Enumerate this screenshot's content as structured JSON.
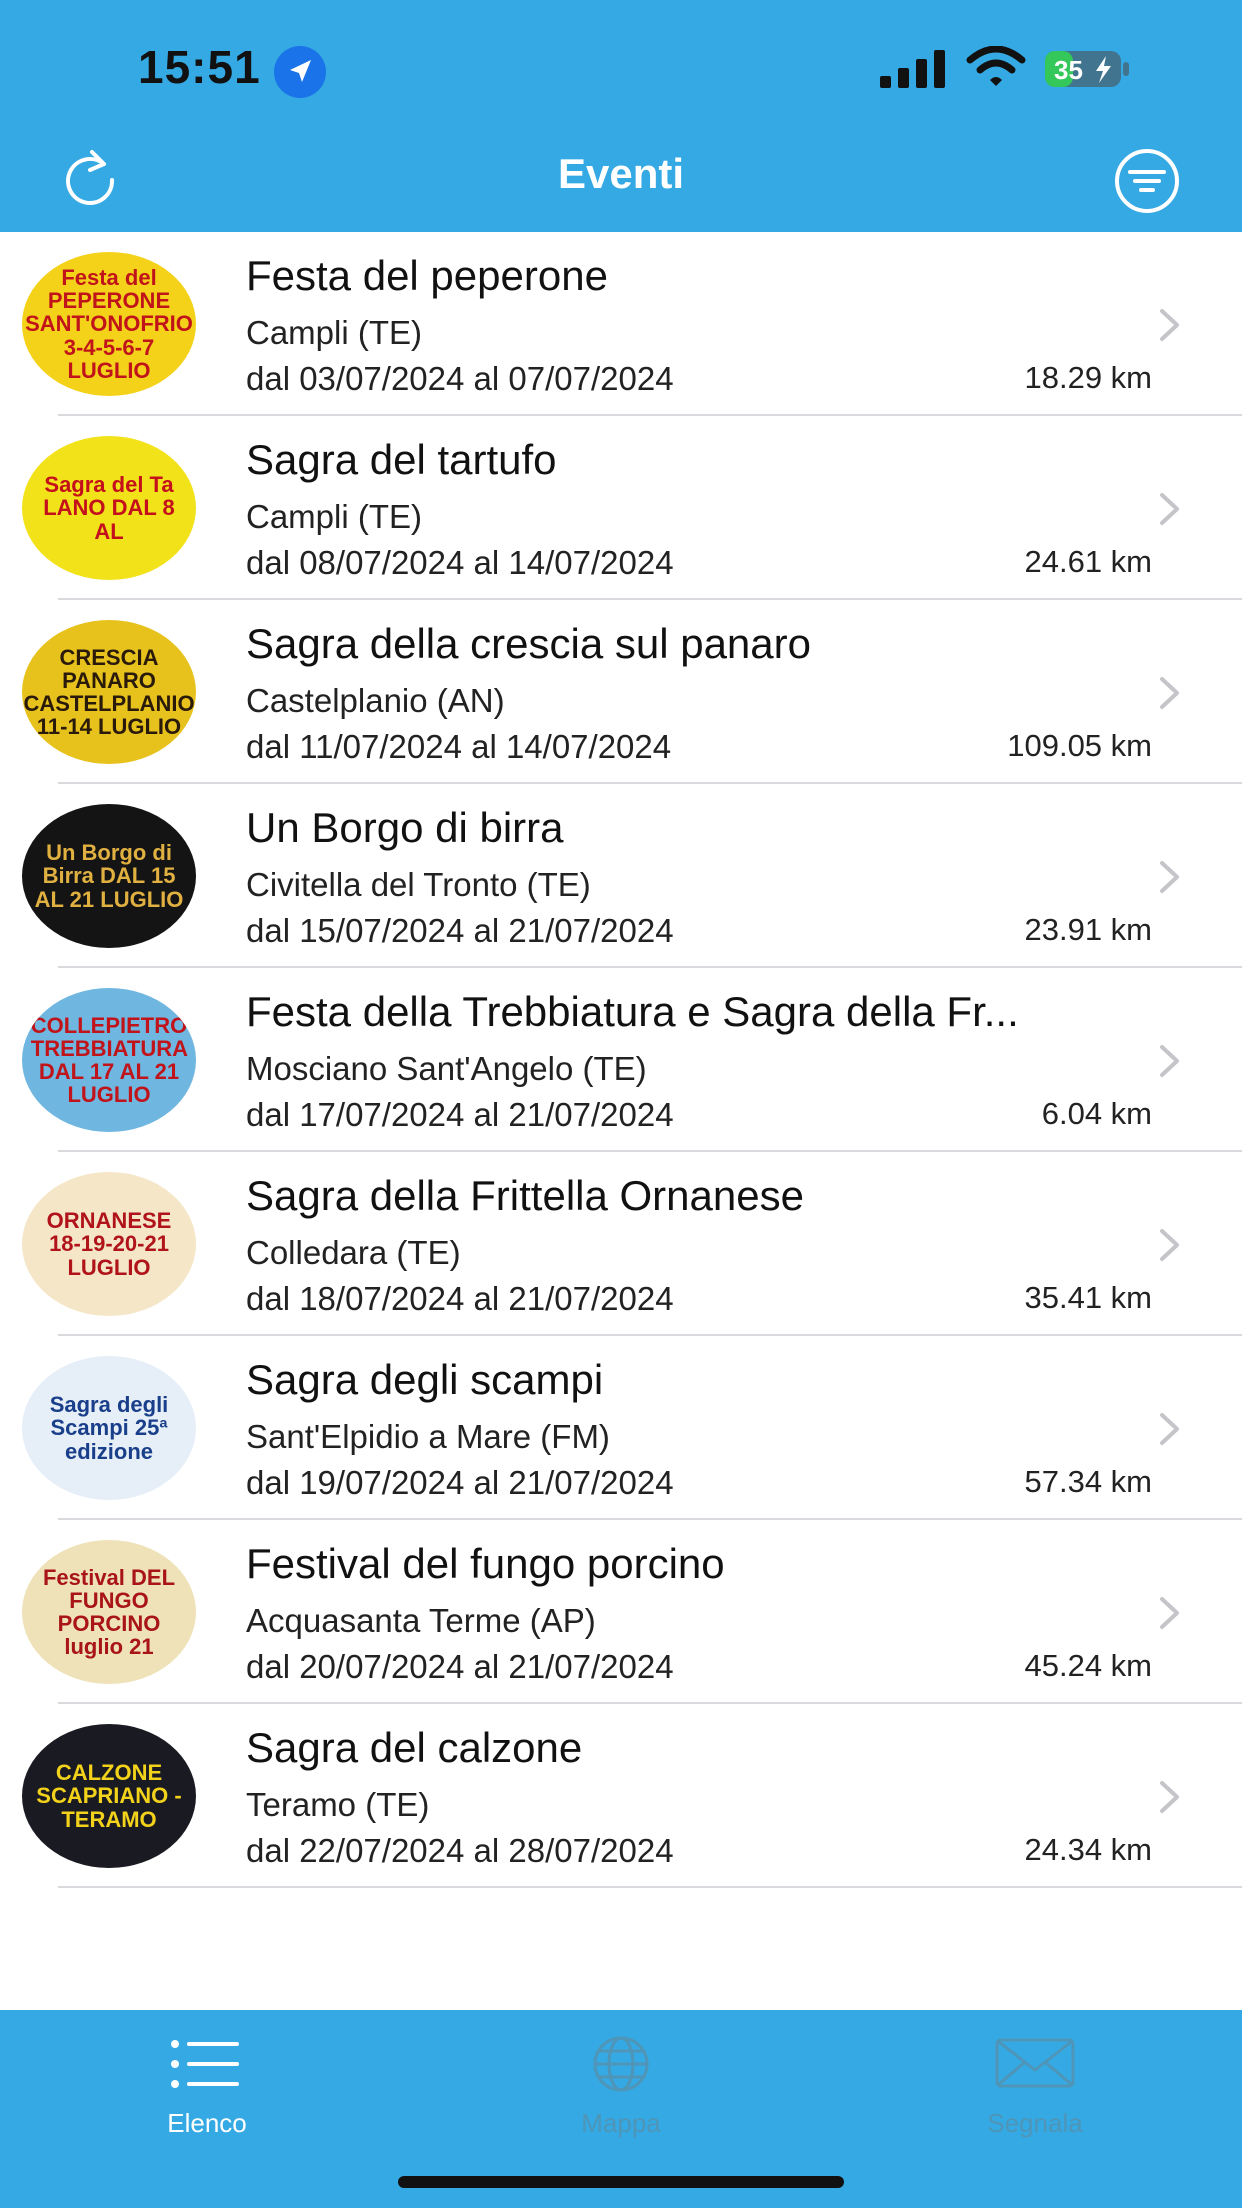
{
  "status": {
    "time": "15:51",
    "battery": "35"
  },
  "header": {
    "title": "Eventi"
  },
  "events": [
    {
      "title": "Festa del peperone",
      "place": "Campli (TE)",
      "dates": "dal 03/07/2024 al 07/07/2024",
      "distance": "18.29 km",
      "thumb_text": "Festa del PEPERONE SANT'ONOFRIO 3-4-5-6-7 LUGLIO",
      "thumb_bg": "#f4d21a",
      "thumb_fg": "#c0141a"
    },
    {
      "title": "Sagra del tartufo",
      "place": "Campli (TE)",
      "dates": "dal 08/07/2024 al 14/07/2024",
      "distance": "24.61 km",
      "thumb_text": "Sagra del Ta LANO DAL 8 AL",
      "thumb_bg": "#f2e21a",
      "thumb_fg": "#c4101a"
    },
    {
      "title": "Sagra della crescia sul panaro",
      "place": "Castelplanio (AN)",
      "dates": "dal 11/07/2024 al 14/07/2024",
      "distance": "109.05 km",
      "thumb_text": "CRESCIA PANARO CASTELPLANIO 11-14 LUGLIO",
      "thumb_bg": "#e8c21c",
      "thumb_fg": "#2a1a0a"
    },
    {
      "title": "Un Borgo di birra",
      "place": "Civitella del Tronto (TE)",
      "dates": "dal 15/07/2024 al 21/07/2024",
      "distance": "23.91 km",
      "thumb_text": "Un Borgo di Birra DAL 15 AL 21 LUGLIO",
      "thumb_bg": "#141414",
      "thumb_fg": "#e0b040"
    },
    {
      "title": "Festa della Trebbiatura e Sagra della Fr...",
      "place": "Mosciano Sant'Angelo (TE)",
      "dates": "dal 17/07/2024 al 21/07/2024",
      "distance": "6.04 km",
      "thumb_text": "COLLEPIETRO TREBBIATURA DAL 17 AL 21 LUGLIO",
      "thumb_bg": "#6fb6e0",
      "thumb_fg": "#c0141a"
    },
    {
      "title": "Sagra della Frittella Ornanese",
      "place": "Colledara (TE)",
      "dates": "dal 18/07/2024 al 21/07/2024",
      "distance": "35.41 km",
      "thumb_text": "ORNANESE 18-19-20-21 LUGLIO",
      "thumb_bg": "#f5e6c8",
      "thumb_fg": "#b0141a"
    },
    {
      "title": "Sagra degli scampi",
      "place": "Sant'Elpidio a Mare (FM)",
      "dates": "dal 19/07/2024 al 21/07/2024",
      "distance": "57.34 km",
      "thumb_text": "Sagra degli Scampi 25ª edizione",
      "thumb_bg": "#e6eef8",
      "thumb_fg": "#1a3f8a"
    },
    {
      "title": "Festival del fungo porcino",
      "place": "Acquasanta Terme (AP)",
      "dates": "dal 20/07/2024 al 21/07/2024",
      "distance": "45.24 km",
      "thumb_text": "Festival DEL FUNGO PORCINO luglio 21",
      "thumb_bg": "#efe2b8",
      "thumb_fg": "#a8141a"
    },
    {
      "title": "Sagra del calzone",
      "place": "Teramo (TE)",
      "dates": "dal 22/07/2024 al 28/07/2024",
      "distance": "24.34 km",
      "thumb_text": "CALZONE SCAPRIANO - TERAMO",
      "thumb_bg": "#1a1a22",
      "thumb_fg": "#f2d21a"
    }
  ],
  "tabs": [
    {
      "label": "Elenco",
      "icon": "list-icon"
    },
    {
      "label": "Mappa",
      "icon": "globe-icon"
    },
    {
      "label": "Segnala",
      "icon": "envelope-icon"
    }
  ],
  "colors": {
    "accent": "#35a9e3",
    "tab_inactive": "#4e95b8"
  }
}
